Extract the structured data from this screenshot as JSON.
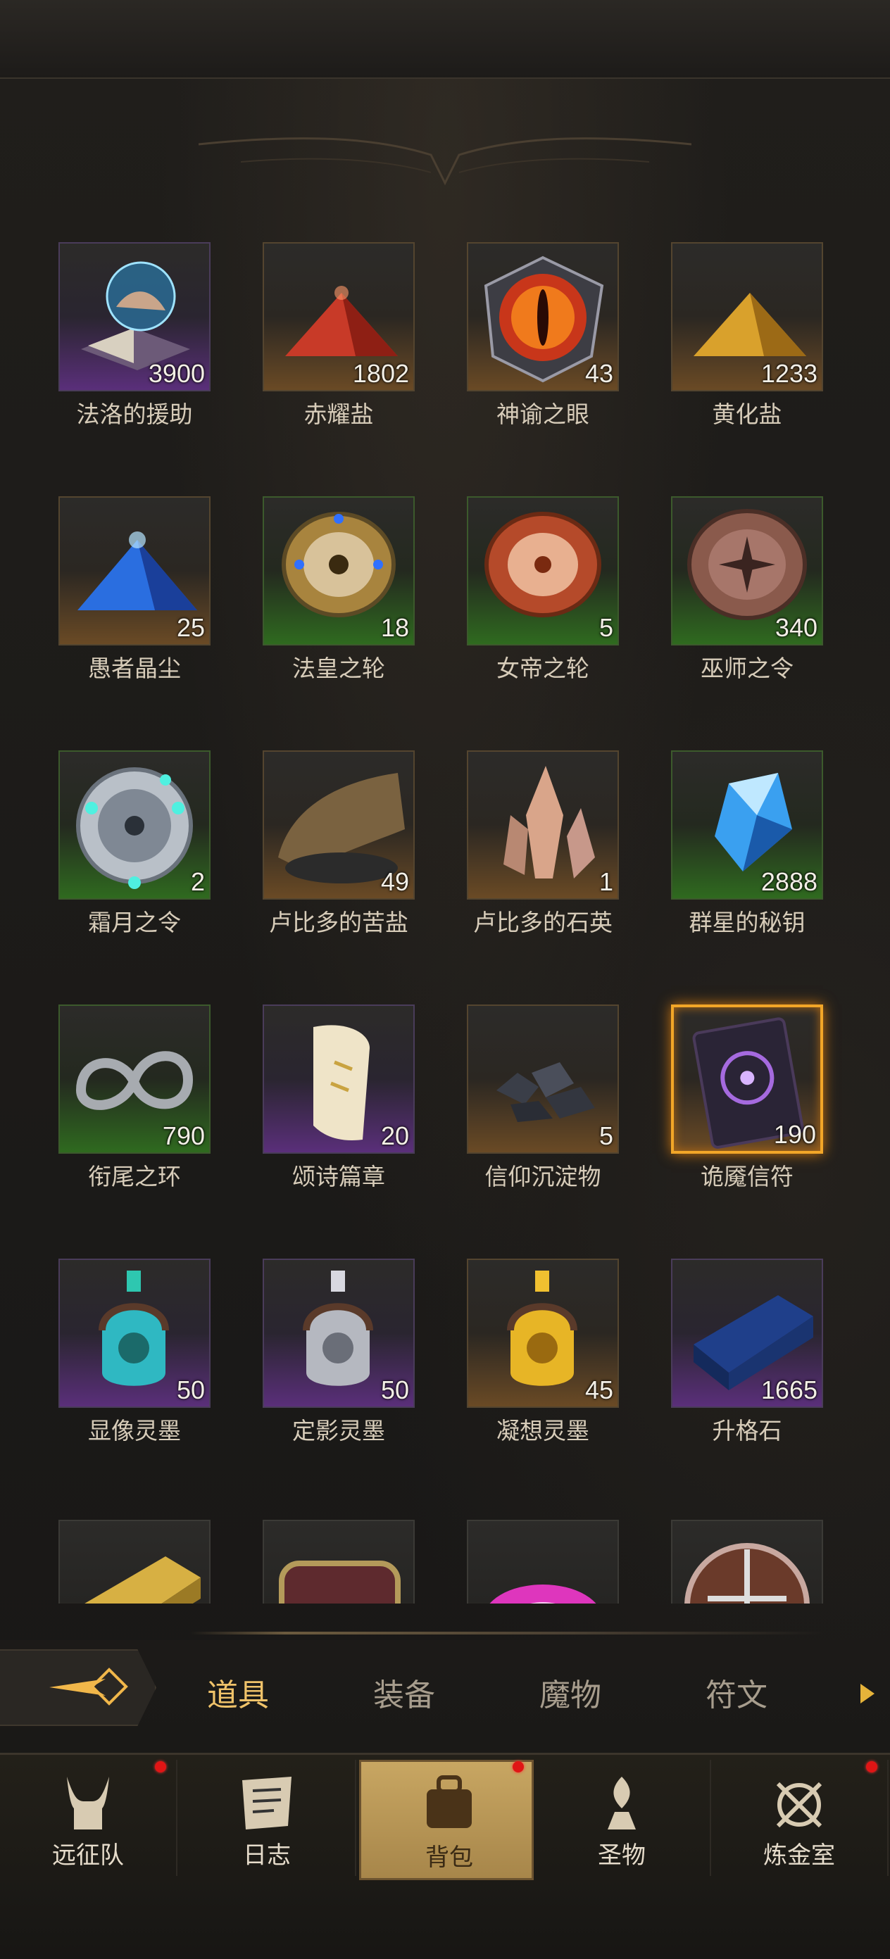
{
  "items": [
    {
      "name": "法洛的援助",
      "count": "3900",
      "rarity": "purple",
      "icon": "tome-orb-icon"
    },
    {
      "name": "赤耀盐",
      "count": "1802",
      "rarity": "orange",
      "icon": "red-salt-icon"
    },
    {
      "name": "神谕之眼",
      "count": "43",
      "rarity": "orange",
      "icon": "oracle-eye-icon"
    },
    {
      "name": "黄化盐",
      "count": "1233",
      "rarity": "orange",
      "icon": "yellow-salt-icon"
    },
    {
      "name": "愚者晶尘",
      "count": "25",
      "rarity": "orange",
      "icon": "blue-crystal-dust-icon"
    },
    {
      "name": "法皇之轮",
      "count": "18",
      "rarity": "green",
      "icon": "gold-wheel-icon"
    },
    {
      "name": "女帝之轮",
      "count": "5",
      "rarity": "green",
      "icon": "copper-wheel-icon"
    },
    {
      "name": "巫师之令",
      "count": "340",
      "rarity": "green",
      "icon": "bronze-seal-icon"
    },
    {
      "name": "霜月之令",
      "count": "2",
      "rarity": "green",
      "icon": "silver-seal-icon"
    },
    {
      "name": "卢比多的苦盐",
      "count": "49",
      "rarity": "orange",
      "icon": "salt-sack-icon"
    },
    {
      "name": "卢比多的石英",
      "count": "1",
      "rarity": "orange",
      "icon": "quartz-icon"
    },
    {
      "name": "群星的秘钥",
      "count": "2888",
      "rarity": "green",
      "icon": "star-gem-icon"
    },
    {
      "name": "衔尾之环",
      "count": "790",
      "rarity": "green",
      "icon": "ouroboros-icon"
    },
    {
      "name": "颂诗篇章",
      "count": "20",
      "rarity": "purple",
      "icon": "scroll-icon"
    },
    {
      "name": "信仰沉淀物",
      "count": "5",
      "rarity": "orange",
      "icon": "ore-icon"
    },
    {
      "name": "诡魇信符",
      "count": "190",
      "rarity": "orange",
      "icon": "nightmare-card-icon",
      "selected": true
    },
    {
      "name": "显像灵墨",
      "count": "50",
      "rarity": "purple",
      "icon": "teal-ink-icon"
    },
    {
      "name": "定影灵墨",
      "count": "50",
      "rarity": "purple",
      "icon": "silver-ink-icon"
    },
    {
      "name": "凝想灵墨",
      "count": "45",
      "rarity": "orange",
      "icon": "gold-ink-icon"
    },
    {
      "name": "升格石",
      "count": "1665",
      "rarity": "purple",
      "icon": "blue-ingot-icon"
    }
  ],
  "partial_row_icons": [
    "gold-ingot-icon",
    "chest-icon",
    "pink-flame-icon",
    "crest-icon"
  ],
  "tabs": [
    "道具",
    "装备",
    "魔物",
    "符文"
  ],
  "active_tab": 0,
  "nav": [
    {
      "label": "远征队",
      "icon": "horned-helmet-icon",
      "dot": true
    },
    {
      "label": "日志",
      "icon": "journal-icon",
      "dot": false
    },
    {
      "label": "背包",
      "icon": "backpack-icon",
      "dot": true,
      "active": true
    },
    {
      "label": "圣物",
      "icon": "relic-icon",
      "dot": false
    },
    {
      "label": "炼金室",
      "icon": "alchemy-icon",
      "dot": true
    }
  ]
}
